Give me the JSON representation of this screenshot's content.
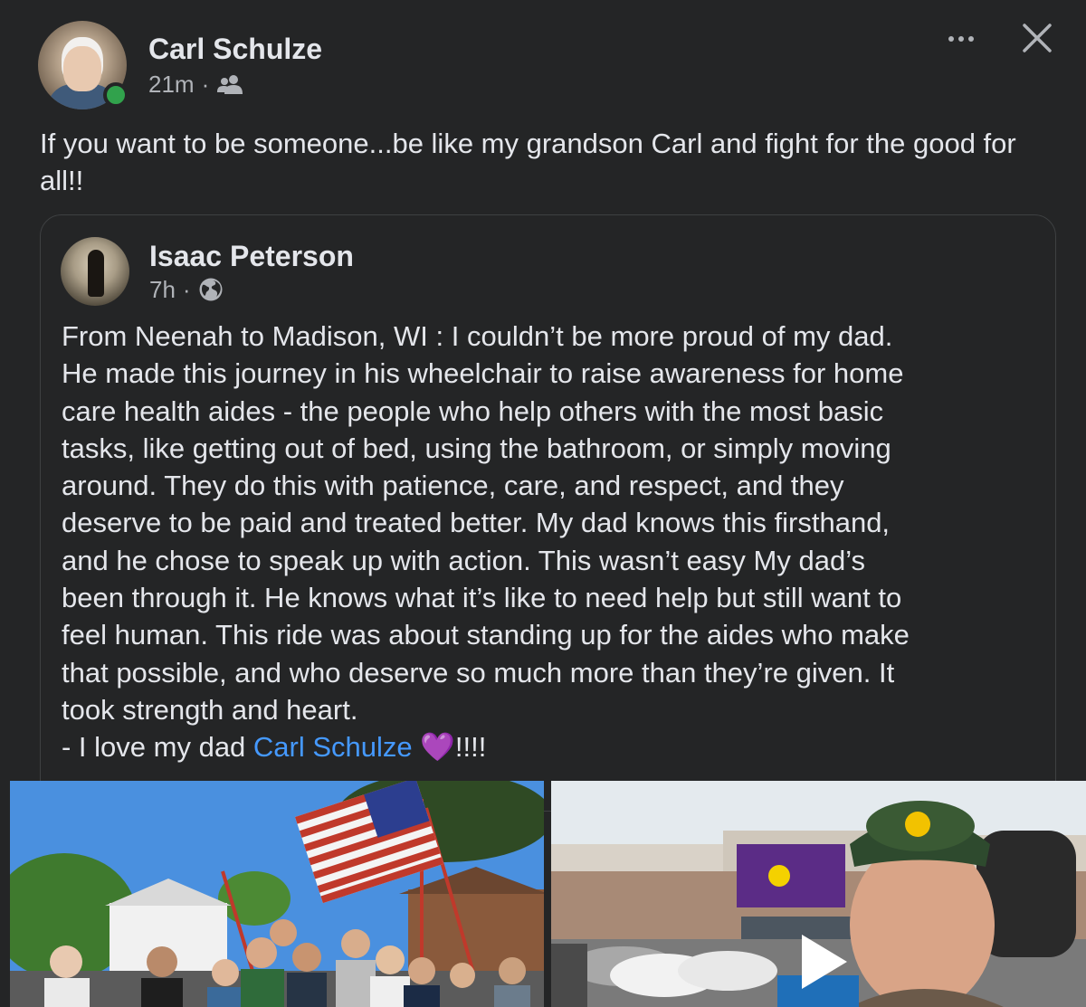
{
  "post": {
    "author": "Carl Schulze",
    "time": "21m",
    "separator": "·",
    "audience_icon": "friends-icon",
    "text": "If you want to be someone...be like my grandson Carl and fight for the good for all!!"
  },
  "shared_post": {
    "author": "Isaac Peterson",
    "time": "7h",
    "separator": "·",
    "audience_icon": "globe-icon",
    "lines": [
      "From Neenah to Madison, WI : I couldn’t be more proud of my dad.",
      "He made this journey in his wheelchair to raise awareness for home",
      "care health aides - the people who help others with the most basic",
      "tasks, like getting out of bed, using the bathroom, or simply moving",
      "around. They do this with patience, care, and respect, and they",
      "deserve to be paid and treated better. My dad knows this firsthand,",
      "and he chose to speak up with action. This wasn’t easy My dad’s",
      "been through it. He knows what it’s like to need help but still want to",
      "feel human. This ride was about standing up for the aides who make",
      "that possible, and who deserve so much more than they’re given. It",
      "took strength and heart."
    ],
    "last_line_prefix": "- I love my dad ",
    "mention": "Carl Schulze",
    "heart_emoji": "💜",
    "last_line_suffix": "!!!!"
  },
  "icons": {
    "more": "more-options-icon",
    "close": "close-icon",
    "play": "play-icon"
  },
  "colors": {
    "background": "#242526",
    "text": "#e4e6eb",
    "secondary_text": "#b0b3b8",
    "mention": "#4599ff",
    "online": "#31a24c",
    "heart": "#a855f7"
  }
}
